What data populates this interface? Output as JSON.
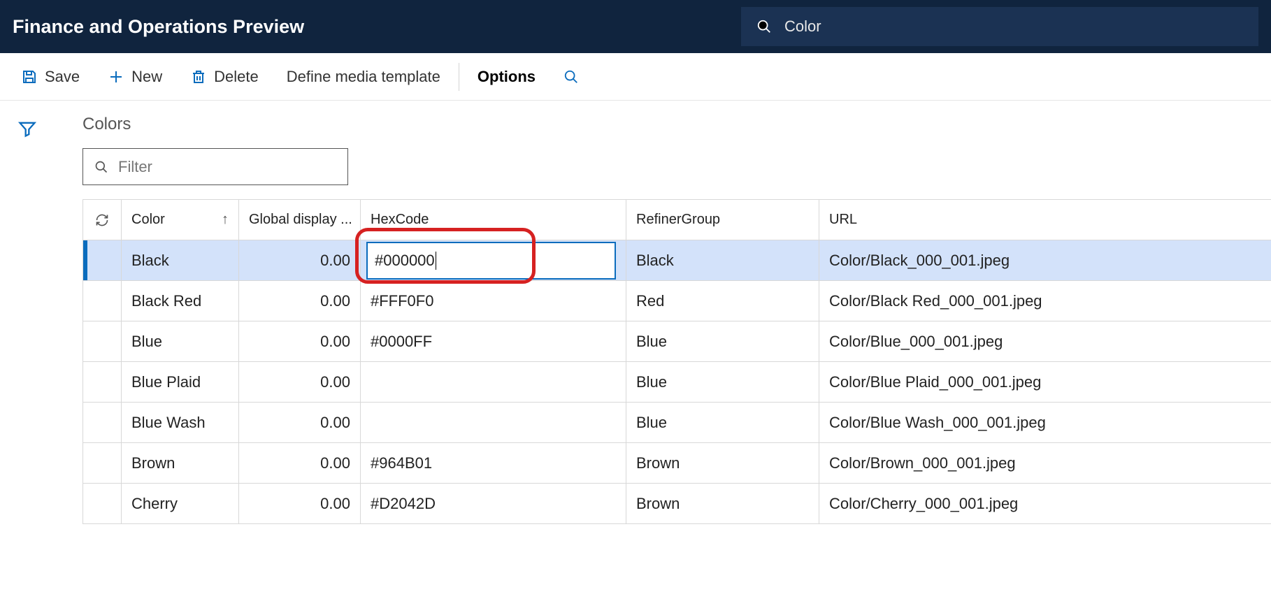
{
  "titlebar": {
    "title": "Finance and Operations Preview"
  },
  "search": {
    "value": "Color"
  },
  "toolbar": {
    "save": "Save",
    "new": "New",
    "delete": "Delete",
    "define": "Define media template",
    "options": "Options"
  },
  "page": {
    "heading": "Colors"
  },
  "filter": {
    "placeholder": "Filter"
  },
  "columns": {
    "color": "Color",
    "gdo": "Global display ...",
    "hex": "HexCode",
    "refiner": "RefinerGroup",
    "url": "URL"
  },
  "rows": [
    {
      "color": "Black",
      "gdo": "0.00",
      "hex": "#000000",
      "refiner": "Black",
      "url": "Color/Black_000_001.jpeg",
      "selected": true,
      "editing": true
    },
    {
      "color": "Black Red",
      "gdo": "0.00",
      "hex": "#FFF0F0",
      "refiner": "Red",
      "url": "Color/Black Red_000_001.jpeg",
      "selected": false,
      "editing": false
    },
    {
      "color": "Blue",
      "gdo": "0.00",
      "hex": "#0000FF",
      "refiner": "Blue",
      "url": "Color/Blue_000_001.jpeg",
      "selected": false,
      "editing": false
    },
    {
      "color": "Blue Plaid",
      "gdo": "0.00",
      "hex": "",
      "refiner": "Blue",
      "url": "Color/Blue Plaid_000_001.jpeg",
      "selected": false,
      "editing": false
    },
    {
      "color": "Blue Wash",
      "gdo": "0.00",
      "hex": "",
      "refiner": "Blue",
      "url": "Color/Blue Wash_000_001.jpeg",
      "selected": false,
      "editing": false
    },
    {
      "color": "Brown",
      "gdo": "0.00",
      "hex": "#964B01",
      "refiner": "Brown",
      "url": "Color/Brown_000_001.jpeg",
      "selected": false,
      "editing": false
    },
    {
      "color": "Cherry",
      "gdo": "0.00",
      "hex": "#D2042D",
      "refiner": "Brown",
      "url": "Color/Cherry_000_001.jpeg",
      "selected": false,
      "editing": false
    }
  ]
}
